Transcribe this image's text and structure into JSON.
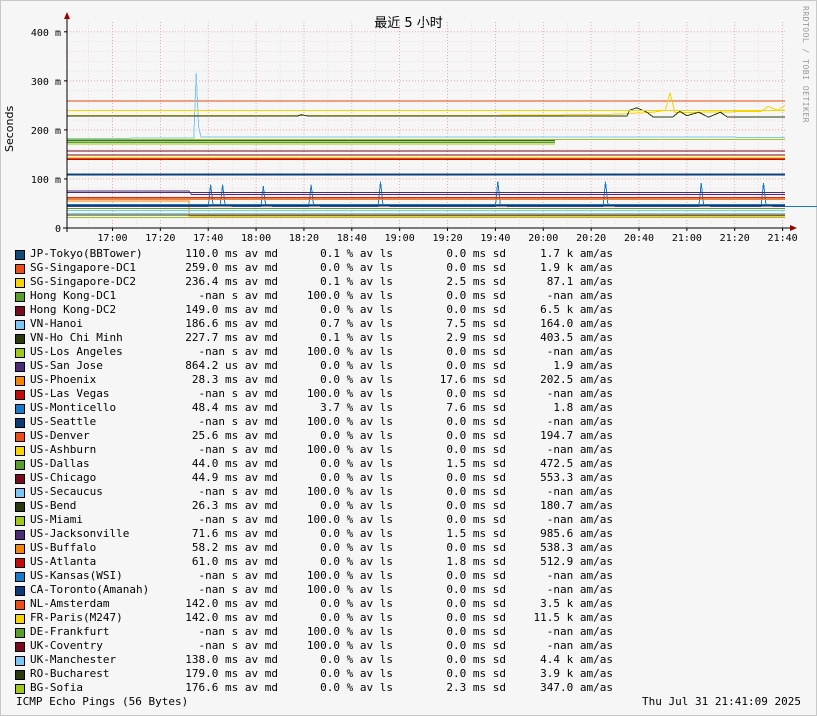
{
  "watermark": "RRDTOOL / TOBI OETIKER",
  "footer": {
    "title": "ICMP Echo Pings (56 Bytes)",
    "timestamp": "Thu Jul 31 21:41:09 2025"
  },
  "chart_data": {
    "type": "line",
    "title": "最近 5 小时",
    "ylabel": "Seconds",
    "y_unit": "ms",
    "ylim": [
      0,
      420
    ],
    "yticks": [
      {
        "value": 0,
        "label": "0"
      },
      {
        "value": 100,
        "label": "100 m"
      },
      {
        "value": 200,
        "label": "200 m"
      },
      {
        "value": 300,
        "label": "300 m"
      },
      {
        "value": 400,
        "label": "400 m"
      }
    ],
    "x_range": [
      "16:41",
      "21:41"
    ],
    "xticks": [
      {
        "minute": 19,
        "label": "17:00"
      },
      {
        "minute": 39,
        "label": "17:20"
      },
      {
        "minute": 59,
        "label": "17:40"
      },
      {
        "minute": 79,
        "label": "18:00"
      },
      {
        "minute": 99,
        "label": "18:20"
      },
      {
        "minute": 119,
        "label": "18:40"
      },
      {
        "minute": 139,
        "label": "19:00"
      },
      {
        "minute": 159,
        "label": "19:20"
      },
      {
        "minute": 179,
        "label": "19:40"
      },
      {
        "minute": 199,
        "label": "20:00"
      },
      {
        "minute": 219,
        "label": "20:20"
      },
      {
        "minute": 239,
        "label": "20:40"
      },
      {
        "minute": 259,
        "label": "21:00"
      },
      {
        "minute": 279,
        "label": "21:20"
      },
      {
        "minute": 299,
        "label": "21:40"
      }
    ],
    "grid": true,
    "legend": "bottom",
    "series": [
      {
        "name": "JP-Tokyo(BBTower)",
        "color": "#0e4a7a",
        "median": "110.0 ms av md",
        "loss": "0.1 % av ls",
        "sd": "0.0 ms sd",
        "amas": "1.7 k am/as",
        "points": [
          [
            0,
            110
          ],
          [
            300,
            110
          ]
        ]
      },
      {
        "name": "SG-Singapore-DC1",
        "color": "#f04a16",
        "median": "259.0 ms av md",
        "loss": "0.0 % av ls",
        "sd": "0.0 ms sd",
        "amas": "1.9 k am/as",
        "points": [
          [
            0,
            259
          ],
          [
            300,
            259
          ]
        ]
      },
      {
        "name": "SG-Singapore-DC2",
        "color": "#f5d400",
        "median": "236.4 ms av md",
        "loss": "0.1 % av ls",
        "sd": "2.5 ms sd",
        "amas": "87.1 am/as",
        "points": [
          [
            0,
            229
          ],
          [
            110,
            229
          ],
          [
            190,
            230
          ],
          [
            230,
            232
          ],
          [
            245,
            236
          ],
          [
            250,
            240
          ],
          [
            252,
            276
          ],
          [
            254,
            235
          ],
          [
            290,
            238
          ],
          [
            293,
            248
          ],
          [
            297,
            240
          ],
          [
            300,
            250
          ]
        ]
      },
      {
        "name": "Hong Kong-DC1",
        "color": "#58a02a",
        "median": "-nan s av md",
        "loss": "100.0 % av ls",
        "sd": "0.0 ms sd",
        "amas": "-nan am/as",
        "points": [
          [
            0,
            177
          ],
          [
            204,
            177
          ]
        ]
      },
      {
        "name": "Hong Kong-DC2",
        "color": "#7a0a1e",
        "median": "149.0 ms av md",
        "loss": "0.0 % av ls",
        "sd": "0.0 ms sd",
        "amas": "6.5 k am/as",
        "points": [
          [
            0,
            149
          ],
          [
            300,
            149
          ]
        ]
      },
      {
        "name": "VN-Hanoi",
        "color": "#7cc5f5",
        "median": "186.6 ms av md",
        "loss": "0.7 % av ls",
        "sd": "7.5 ms sd",
        "amas": "164.0 am/as",
        "points": [
          [
            0,
            182
          ],
          [
            53,
            184
          ],
          [
            54,
            316
          ],
          [
            55,
            206
          ],
          [
            56,
            186
          ],
          [
            300,
            185
          ]
        ]
      },
      {
        "name": "VN-Ho Chi Minh",
        "color": "#283a0e",
        "median": "227.7 ms av md",
        "loss": "0.1 % av ls",
        "sd": "2.9 ms sd",
        "amas": "403.5 am/as",
        "points": [
          [
            0,
            228
          ],
          [
            96,
            228
          ],
          [
            98,
            231
          ],
          [
            101,
            228
          ],
          [
            234,
            228
          ],
          [
            235,
            240
          ],
          [
            238,
            245
          ],
          [
            242,
            237
          ],
          [
            245,
            226
          ],
          [
            253,
            226
          ],
          [
            256,
            238
          ],
          [
            259,
            229
          ],
          [
            264,
            236
          ],
          [
            268,
            226
          ],
          [
            273,
            236
          ],
          [
            276,
            226
          ],
          [
            300,
            226
          ]
        ]
      },
      {
        "name": "US-Los Angeles",
        "color": "#a0c818",
        "median": "-nan s av md",
        "loss": "100.0 % av ls",
        "sd": "0.0 ms sd",
        "amas": "-nan am/as",
        "points": [
          [
            0,
            171
          ],
          [
            204,
            171
          ]
        ]
      },
      {
        "name": "US-San Jose",
        "color": "#4c2a78",
        "median": "864.2 us av md",
        "loss": "0.0 % av ls",
        "sd": "0.0 ms sd",
        "amas": "1.9 am/as",
        "points": [
          [
            0,
            75
          ],
          [
            51,
            75
          ],
          [
            52,
            68
          ],
          [
            300,
            68
          ]
        ]
      },
      {
        "name": "US-Phoenix",
        "color": "#f5840a",
        "median": "28.3 ms av md",
        "loss": "0.0 % av ls",
        "sd": "17.6 ms sd",
        "amas": "202.5 am/as",
        "points": [
          [
            0,
            55
          ],
          [
            51,
            55
          ],
          [
            51,
            24
          ],
          [
            300,
            24
          ]
        ]
      },
      {
        "name": "US-Las Vegas",
        "color": "#c40a0a",
        "median": "-nan s av md",
        "loss": "100.0 % av ls",
        "sd": "0.0 ms sd",
        "amas": "-nan am/as",
        "points": [
          [
            0,
            140
          ],
          [
            300,
            140
          ]
        ]
      },
      {
        "name": "US-Monticello",
        "color": "#1a7ac8",
        "median": "48.4 ms av md",
        "loss": "3.7 % av ls",
        "sd": "7.6 ms sd",
        "amas": "1.8 am/as",
        "points": [
          [
            0,
            44
          ],
          [
            59,
            44
          ],
          [
            60,
            88
          ],
          [
            61,
            48
          ],
          [
            64,
            46
          ],
          [
            65,
            88
          ],
          [
            66,
            48
          ],
          [
            69,
            44
          ],
          [
            81,
            44
          ],
          [
            82,
            85
          ],
          [
            83,
            48
          ],
          [
            86,
            44
          ],
          [
            101,
            44
          ],
          [
            102,
            88
          ],
          [
            103,
            48
          ],
          [
            106,
            44
          ],
          [
            130,
            44
          ],
          [
            131,
            95
          ],
          [
            132,
            48
          ],
          [
            135,
            44
          ],
          [
            179,
            44
          ],
          [
            180,
            95
          ],
          [
            181,
            48
          ],
          [
            184,
            44
          ],
          [
            224,
            44
          ],
          [
            225,
            95
          ],
          [
            226,
            48
          ],
          [
            229,
            44
          ],
          [
            264,
            44
          ],
          [
            265,
            92
          ],
          [
            266,
            48
          ],
          [
            269,
            44
          ],
          [
            290,
            44
          ],
          [
            291,
            92
          ],
          [
            292,
            48
          ],
          [
            295,
            44
          ],
          [
            315,
            44
          ],
          [
            316,
            80
          ],
          [
            317,
            48
          ],
          [
            320,
            44
          ],
          [
            350,
            44
          ],
          [
            351,
            90
          ],
          [
            352,
            48
          ],
          [
            355,
            44
          ]
        ]
      },
      {
        "name": "US-Seattle",
        "color": "#0a3a78",
        "median": "-nan s av md",
        "loss": "100.0 % av ls",
        "sd": "0.0 ms sd",
        "amas": "-nan am/as",
        "points": [
          [
            0,
            108
          ],
          [
            300,
            108
          ]
        ]
      },
      {
        "name": "US-Denver",
        "color": "#f04a16",
        "median": "25.6 ms av md",
        "loss": "0.0 % av ls",
        "sd": "0.0 ms sd",
        "amas": "194.7 am/as",
        "points": [
          [
            0,
            62
          ],
          [
            300,
            62
          ]
        ]
      },
      {
        "name": "US-Ashburn",
        "color": "#f5d400",
        "median": "-nan s av md",
        "loss": "100.0 % av ls",
        "sd": "0.0 ms sd",
        "amas": "-nan am/as",
        "points": [
          [
            0,
            240
          ],
          [
            300,
            240
          ]
        ]
      },
      {
        "name": "US-Dallas",
        "color": "#58a02a",
        "median": "44.0 ms av md",
        "loss": "0.0 % av ls",
        "sd": "1.5 ms sd",
        "amas": "472.5 am/as",
        "points": [
          [
            0,
            40
          ],
          [
            300,
            40
          ]
        ]
      },
      {
        "name": "US-Chicago",
        "color": "#7a0a1e",
        "median": "44.9 ms av md",
        "loss": "0.0 % av ls",
        "sd": "0.0 ms sd",
        "amas": "553.3 am/as",
        "points": [
          [
            0,
            45
          ],
          [
            300,
            45
          ]
        ]
      },
      {
        "name": "US-Secaucus",
        "color": "#7cc5f5",
        "median": "-nan s av md",
        "loss": "100.0 % av ls",
        "sd": "0.0 ms sd",
        "amas": "-nan am/as",
        "points": [
          [
            0,
            30
          ],
          [
            300,
            30
          ]
        ]
      },
      {
        "name": "US-Bend",
        "color": "#283a0e",
        "median": "26.3 ms av md",
        "loss": "0.0 % av ls",
        "sd": "0.0 ms sd",
        "amas": "180.7 am/as",
        "points": [
          [
            0,
            26
          ],
          [
            300,
            26
          ]
        ]
      },
      {
        "name": "US-Miami",
        "color": "#a0c818",
        "median": "-nan s av md",
        "loss": "100.0 % av ls",
        "sd": "0.0 ms sd",
        "amas": "-nan am/as",
        "points": [
          [
            0,
            21
          ],
          [
            300,
            21
          ]
        ]
      },
      {
        "name": "US-Jacksonville",
        "color": "#4c2a78",
        "median": "71.6 ms av md",
        "loss": "0.0 % av ls",
        "sd": "1.5 ms sd",
        "amas": "985.6 am/as",
        "points": [
          [
            0,
            72
          ],
          [
            300,
            72
          ]
        ]
      },
      {
        "name": "US-Buffalo",
        "color": "#f5840a",
        "median": "58.2 ms av md",
        "loss": "0.0 % av ls",
        "sd": "0.0 ms sd",
        "amas": "538.3 am/as",
        "points": [
          [
            0,
            58
          ],
          [
            300,
            58
          ]
        ]
      },
      {
        "name": "US-Atlanta",
        "color": "#c40a0a",
        "median": "61.0 ms av md",
        "loss": "0.0 % av ls",
        "sd": "1.8 ms sd",
        "amas": "512.9 am/as",
        "points": [
          [
            0,
            61
          ],
          [
            300,
            61
          ]
        ]
      },
      {
        "name": "US-Kansas(WSI)",
        "color": "#1a7ac8",
        "median": "-nan s av md",
        "loss": "100.0 % av ls",
        "sd": "0.0 ms sd",
        "amas": "-nan am/as",
        "points": [
          [
            0,
            48
          ],
          [
            300,
            48
          ]
        ]
      },
      {
        "name": "CA-Toronto(Amanah)",
        "color": "#0a3a78",
        "median": "-nan s av md",
        "loss": "100.0 % av ls",
        "sd": "0.0 ms sd",
        "amas": "-nan am/as",
        "points": [
          [
            0,
            46
          ],
          [
            300,
            46
          ]
        ]
      },
      {
        "name": "NL-Amsterdam",
        "color": "#f04a16",
        "median": "142.0 ms av md",
        "loss": "0.0 % av ls",
        "sd": "0.0 ms sd",
        "amas": "3.5 k am/as",
        "points": [
          [
            0,
            142
          ],
          [
            300,
            142
          ]
        ]
      },
      {
        "name": "FR-Paris(M247)",
        "color": "#f5d400",
        "median": "142.0 ms av md",
        "loss": "0.0 % av ls",
        "sd": "0.0 ms sd",
        "amas": "11.5 k am/as",
        "points": [
          [
            0,
            144
          ],
          [
            300,
            144
          ]
        ]
      },
      {
        "name": "DE-Frankfurt",
        "color": "#58a02a",
        "median": "-nan s av md",
        "loss": "100.0 % av ls",
        "sd": "0.0 ms sd",
        "amas": "-nan am/as",
        "points": [
          [
            0,
            174
          ],
          [
            204,
            174
          ]
        ]
      },
      {
        "name": "UK-Coventry",
        "color": "#7a0a1e",
        "median": "-nan s av md",
        "loss": "100.0 % av ls",
        "sd": "0.0 ms sd",
        "amas": "-nan am/as",
        "points": [
          [
            0,
            157
          ],
          [
            300,
            157
          ]
        ]
      },
      {
        "name": "UK-Manchester",
        "color": "#7cc5f5",
        "median": "138.0 ms av md",
        "loss": "0.0 % av ls",
        "sd": "0.0 ms sd",
        "amas": "4.4 k am/as",
        "points": [
          [
            0,
            36
          ],
          [
            300,
            36
          ]
        ]
      },
      {
        "name": "RO-Bucharest",
        "color": "#283a0e",
        "median": "179.0 ms av md",
        "loss": "0.0 % av ls",
        "sd": "0.0 ms sd",
        "amas": "3.9 k am/as",
        "points": [
          [
            0,
            179
          ],
          [
            204,
            179
          ]
        ]
      },
      {
        "name": "BG-Sofia",
        "color": "#a0c818",
        "median": "176.6 ms av md",
        "loss": "0.0 % av ls",
        "sd": "2.3 ms sd",
        "amas": "347.0 am/as",
        "points": [
          [
            0,
            180
          ],
          [
            300,
            180
          ]
        ]
      }
    ]
  }
}
